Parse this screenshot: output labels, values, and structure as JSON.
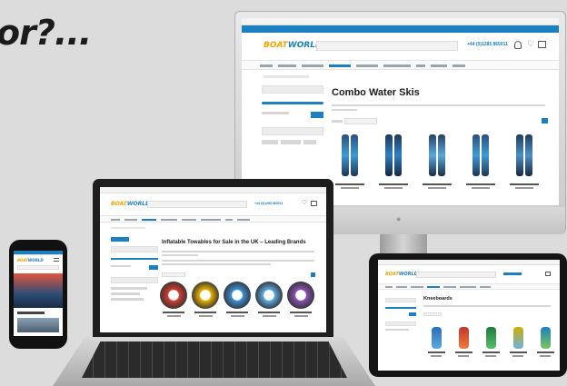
{
  "headline": "or?...",
  "colors": {
    "brand_blue": "#1b7fc0",
    "brand_orange": "#f5a300",
    "background": "#dcdcdc"
  },
  "monitor": {
    "logo_part1": "BOAT",
    "logo_part2": "WORLD",
    "phone": "+44 (0)1285 865011",
    "page_title": "Combo Water Skis"
  },
  "laptop": {
    "logo_part1": "BOAT",
    "logo_part2": "WORLD",
    "phone": "+44 (0)1285 865011",
    "page_title": "Inflatable Towables for Sale in the UK – Leading Brands"
  },
  "tablet": {
    "logo_part1": "BOAT",
    "logo_part2": "WORLD",
    "page_title": "Kneeboards"
  },
  "phone": {
    "logo_part1": "BOAT",
    "logo_part2": "WORLD"
  }
}
